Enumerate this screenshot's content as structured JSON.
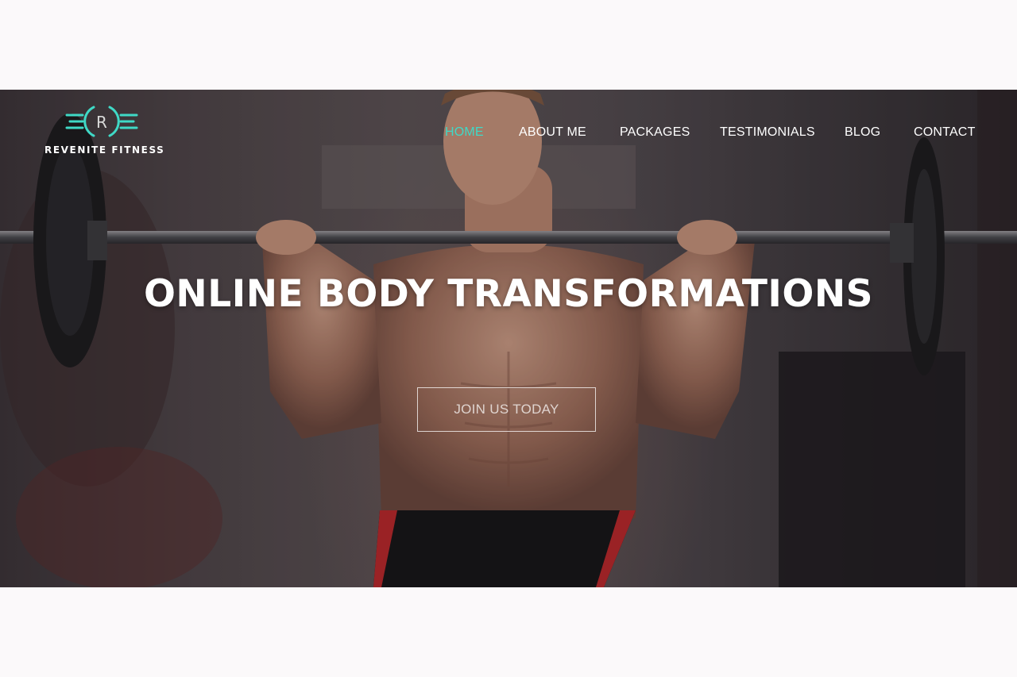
{
  "brand": {
    "logo_letter": "R",
    "name": "REVENITE FITNESS",
    "accent_color": "#3fd9c6"
  },
  "nav": {
    "items": [
      {
        "label": "HOME",
        "active": true
      },
      {
        "label": "ABOUT ME",
        "active": false
      },
      {
        "label": "PACKAGES",
        "active": false
      },
      {
        "label": "TESTIMONIALS",
        "active": false
      },
      {
        "label": "BLOG",
        "active": false
      },
      {
        "label": "CONTACT",
        "active": false
      }
    ]
  },
  "hero": {
    "headline": "ONLINE BODY TRANSFORMATIONS",
    "cta_label": "JOIN US TODAY",
    "background_image": "athlete-barbell-photo"
  }
}
